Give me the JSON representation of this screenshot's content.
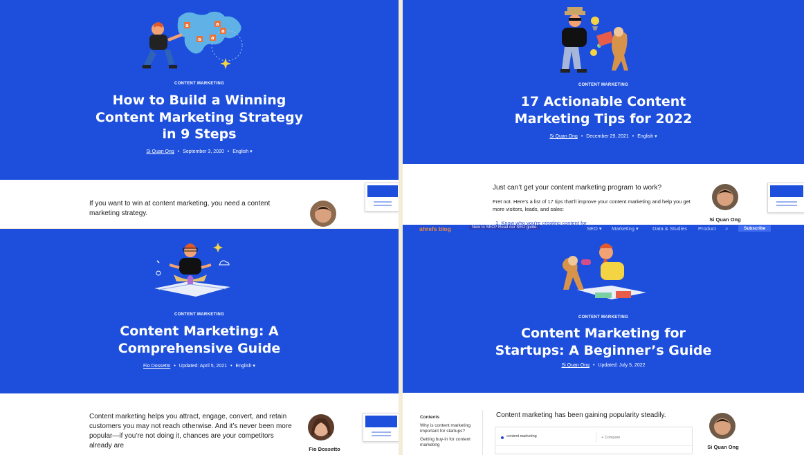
{
  "panels": [
    {
      "category": "CONTENT MARKETING",
      "title_lines": [
        "How to Build a Winning",
        "Content Marketing Strategy",
        "in 9 Steps"
      ],
      "author": "Si Quan Ong",
      "date": "September 3, 2020",
      "language": "English",
      "body": "If you want to win at content marketing, you need a content marketing strategy."
    },
    {
      "category": "CONTENT MARKETING",
      "title_lines": [
        "17 Actionable Content",
        "Marketing Tips for 2022"
      ],
      "author": "Si Quan Ong",
      "date": "December 29, 2021",
      "language": "English",
      "intro": "Just can’t get your content marketing program to work?",
      "body": "Fret not. Here’s a list of 17 tips that’ll improve your content marketing and help you get more visitors, leads, and sales:",
      "list_item": "1. Know who you’re creating content for",
      "author_label": "Si Quan Ong"
    },
    {
      "category": "CONTENT MARKETING",
      "title_lines": [
        "Content Marketing: A",
        "Comprehensive Guide"
      ],
      "author": "Fio Dossetto",
      "date": "Updated: April 5, 2021",
      "language": "English",
      "body": "Content marketing helps you attract, engage, convert, and retain customers you may not reach otherwise. And it’s never been more popular—if you’re not doing it, chances are your competitors already are",
      "author_label": "Fio Dossetto"
    },
    {
      "category": "CONTENT MARKETING",
      "title_lines": [
        "Content Marketing for",
        "Startups: A Beginner’s Guide"
      ],
      "author": "Si Quan Ong",
      "date": "Updated: July 5, 2022",
      "body": "Content marketing has been gaining popularity steadily.",
      "author_label": "Si Quan Ong",
      "nav": {
        "logo": "ahrefs blog",
        "banner": "New to SEO? Read our SEO guide.",
        "items": [
          "SEO ▾",
          "Marketing ▾",
          "Data & Studies",
          "Product"
        ],
        "subscribe": "Subscribe"
      },
      "toc": {
        "heading": "Contents",
        "items": [
          "Why is content marketing important for startups?",
          "Getting buy-in for content marketing"
        ]
      },
      "compare": {
        "left": "content marketing",
        "right": "Compare"
      }
    }
  ],
  "colors": {
    "hero": "#1d4fdc",
    "accent": "#2b4bd6",
    "link": "#2347c9"
  }
}
